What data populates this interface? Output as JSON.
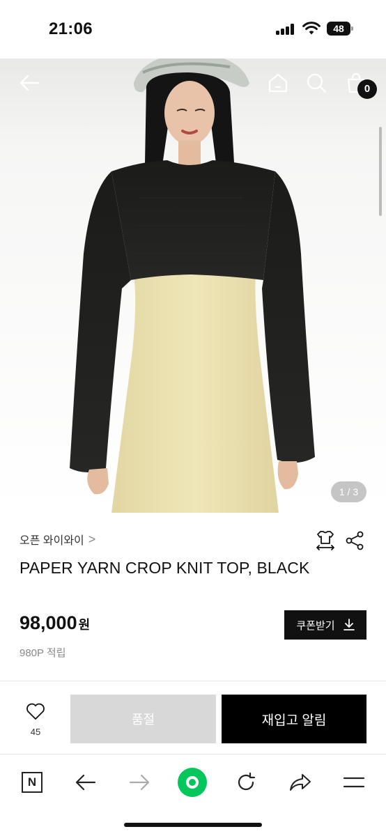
{
  "status_bar": {
    "time": "21:06",
    "battery": "48",
    "icons": [
      "cellular-signal-icon",
      "wifi-icon",
      "battery-icon"
    ]
  },
  "header": {
    "icons": [
      "back-arrow-icon",
      "home-icon",
      "search-icon",
      "shopping-bag-icon"
    ],
    "cart_count": "0"
  },
  "gallery": {
    "counter": "1 / 3"
  },
  "product": {
    "brand": "오픈 와이와이",
    "brand_chevron": ">",
    "name": "PAPER YARN CROP KNIT TOP, BLACK",
    "price": "98,000",
    "price_unit": "원",
    "points": "980P 적립",
    "icons": [
      "size-guide-icon",
      "share-icon"
    ]
  },
  "coupon": {
    "label": "쿠폰받기",
    "icon": "download-icon"
  },
  "actions": {
    "wish_count": "45",
    "soldout_label": "품절",
    "restock_label": "재입고 알림",
    "colors": {
      "soldout_bg": "#d8d8d8",
      "restock_bg": "#000000"
    }
  },
  "browser_toolbar": {
    "naver_label": "N",
    "icons": [
      "naver-n-icon",
      "back-icon",
      "forward-icon",
      "green-dot-icon",
      "refresh-icon",
      "share-arrow-icon",
      "menu-icon"
    ],
    "accent": "#03c75a"
  }
}
